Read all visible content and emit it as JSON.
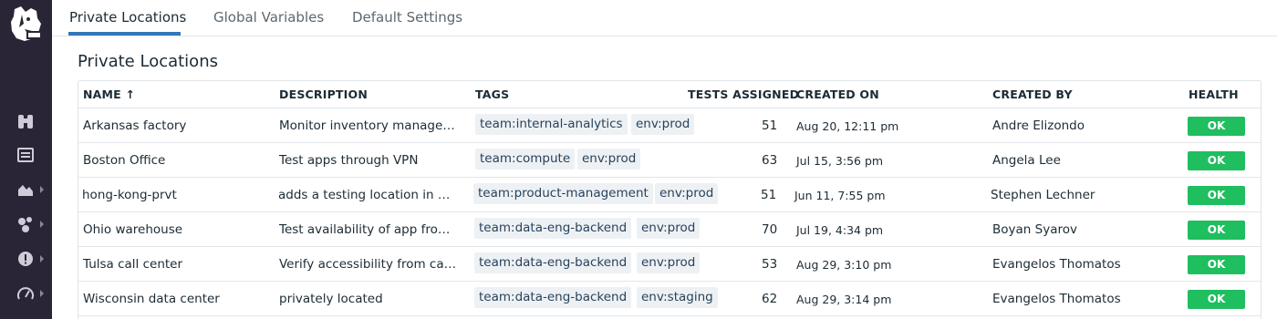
{
  "tabs": [
    {
      "label": "Private Locations",
      "active": true
    },
    {
      "label": "Global Variables",
      "active": false
    },
    {
      "label": "Default Settings",
      "active": false
    }
  ],
  "section_title": "Private Locations",
  "table": {
    "columns": {
      "name": "NAME ↑",
      "description": "DESCRIPTION",
      "tags": "TAGS",
      "tests_assigned": "TESTS ASSIGNED",
      "created_on": "CREATED ON",
      "created_by": "CREATED BY",
      "health": "HEALTH"
    },
    "rows": [
      {
        "name": "Arkansas factory",
        "description": "Monitor inventory manage…",
        "tags": [
          "team:internal-analytics",
          "env:prod"
        ],
        "tests_assigned": "51",
        "created_on": "Aug 20, 12:11 pm",
        "created_by": "Andre Elizondo",
        "health": "OK"
      },
      {
        "name": "Boston Office",
        "description": "Test apps through VPN",
        "tags": [
          "team:compute",
          "env:prod"
        ],
        "tests_assigned": "63",
        "created_on": "Jul 15, 3:56 pm",
        "created_by": "Angela Lee",
        "health": "OK"
      },
      {
        "name": "hong-kong-prvt",
        "description": "adds a testing location in …",
        "tags": [
          "team:product-management",
          "env:prod"
        ],
        "tests_assigned": "51",
        "created_on": "Jun 11, 7:55 pm",
        "created_by": "Stephen Lechner",
        "health": "OK"
      },
      {
        "name": "Ohio warehouse",
        "description": "Test availability of app fro…",
        "tags": [
          "team:data-eng-backend",
          "env:prod"
        ],
        "tests_assigned": "70",
        "created_on": "Jul 19, 4:34 pm",
        "created_by": "Boyan Syarov",
        "health": "OK"
      },
      {
        "name": "Tulsa call center",
        "description": "Verify accessibility from ca…",
        "tags": [
          "team:data-eng-backend",
          "env:prod"
        ],
        "tests_assigned": "53",
        "created_on": "Aug 29, 3:10 pm",
        "created_by": "Evangelos Thomatos",
        "health": "OK"
      },
      {
        "name": "Wisconsin data center",
        "description": "privately located",
        "tags": [
          "team:data-eng-backend",
          "env:staging"
        ],
        "tests_assigned": "62",
        "created_on": "Aug 29, 3:14 pm",
        "created_by": "Evangelos Thomatos",
        "health": "OK"
      }
    ]
  },
  "sidebar": {
    "items": [
      {
        "icon": "binoculars-icon"
      },
      {
        "icon": "list-icon"
      },
      {
        "icon": "area-chart-icon"
      },
      {
        "icon": "hexagon-cluster-icon"
      },
      {
        "icon": "alert-circle-icon"
      },
      {
        "icon": "gauge-icon"
      }
    ]
  },
  "colors": {
    "sidebar_bg": "#2a2536",
    "tab_active_underline": "#3277b9",
    "health_ok": "#1fbe5f",
    "tag_bg": "#eef1f4"
  }
}
